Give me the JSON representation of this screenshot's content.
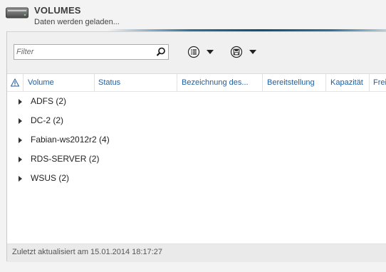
{
  "header": {
    "title": "VOLUMES",
    "subtitle": "Daten werden geladen...",
    "icon": "drive-icon"
  },
  "toolbar": {
    "filter_placeholder": "Filter",
    "filter_value": "",
    "search_icon": "search-icon",
    "tasks_icon": "list-tasks-icon",
    "save_icon": "save-query-icon"
  },
  "columns": [
    {
      "label": "Volume"
    },
    {
      "label": "Status"
    },
    {
      "label": "Bezeichnung des..."
    },
    {
      "label": "Bereitstellung"
    },
    {
      "label": "Kapazität"
    },
    {
      "label": "Frei"
    }
  ],
  "groups": [
    {
      "label": "ADFS (2)"
    },
    {
      "label": "DC-2 (2)"
    },
    {
      "label": "Fabian-ws2012r2 (4)"
    },
    {
      "label": "RDS-SERVER (2)"
    },
    {
      "label": "WSUS (2)"
    }
  ],
  "status": {
    "text": "Zuletzt aktualisiert am 15.01.2014 18:17:27"
  },
  "colors": {
    "accent": "#1f5fa0",
    "progress": "#0f4f78"
  }
}
